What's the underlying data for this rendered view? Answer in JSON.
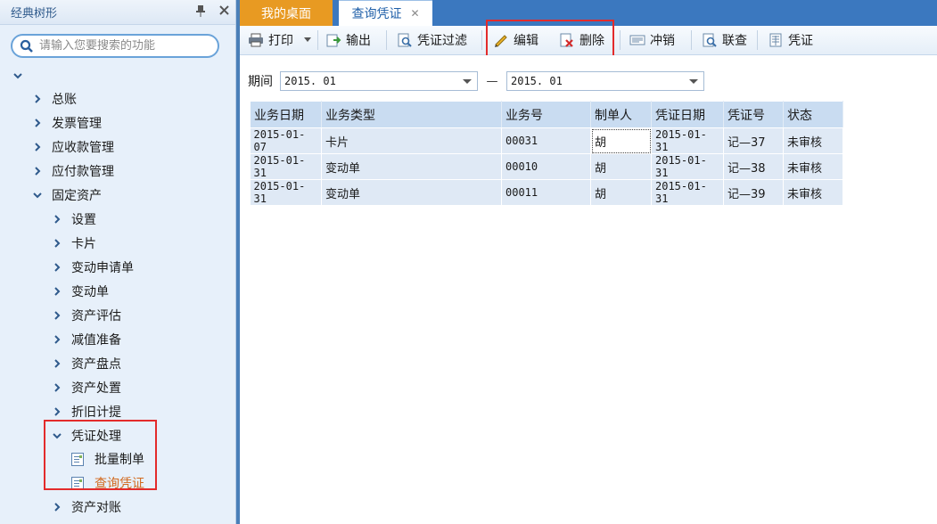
{
  "sidebar": {
    "title": "经典树形",
    "search_placeholder": "请输入您要搜索的功能",
    "tree": [
      {
        "label": "总账"
      },
      {
        "label": "发票管理"
      },
      {
        "label": "应收款管理"
      },
      {
        "label": "应付款管理"
      },
      {
        "label": "固定资产"
      },
      {
        "label": "设置"
      },
      {
        "label": "卡片"
      },
      {
        "label": "变动申请单"
      },
      {
        "label": "变动单"
      },
      {
        "label": "资产评估"
      },
      {
        "label": "减值准备"
      },
      {
        "label": "资产盘点"
      },
      {
        "label": "资产处置"
      },
      {
        "label": "折旧计提"
      },
      {
        "label": "凭证处理"
      },
      {
        "label": "批量制单"
      },
      {
        "label": "查询凭证"
      },
      {
        "label": "资产对账"
      }
    ]
  },
  "tabs": [
    {
      "label": "我的桌面"
    },
    {
      "label": "查询凭证"
    }
  ],
  "toolbar": {
    "print": "打印",
    "export": "输出",
    "filter": "凭证过滤",
    "edit": "编辑",
    "delete": "删除",
    "reverse": "冲销",
    "query": "联查",
    "voucher": "凭证"
  },
  "period": {
    "label": "期间",
    "from": "2015. 01",
    "separator": "—",
    "to": "2015. 01"
  },
  "table": {
    "headers": [
      "业务日期",
      "业务类型",
      "业务号",
      "制单人",
      "凭证日期",
      "凭证号",
      "状态"
    ],
    "rows": [
      [
        "2015-01-07",
        "卡片",
        "00031",
        "胡",
        "2015-01-31",
        "记—37",
        "未审核"
      ],
      [
        "2015-01-31",
        "变动单",
        "00010",
        "胡",
        "2015-01-31",
        "记—38",
        "未审核"
      ],
      [
        "2015-01-31",
        "变动单",
        "00011",
        "胡",
        "2015-01-31",
        "记—39",
        "未审核"
      ]
    ]
  },
  "colors": {
    "tab_active_orange": "#e89a22",
    "tabbar_blue": "#3b78bf",
    "highlight_red": "#e32b2b",
    "active_leaf": "#d2691e"
  }
}
